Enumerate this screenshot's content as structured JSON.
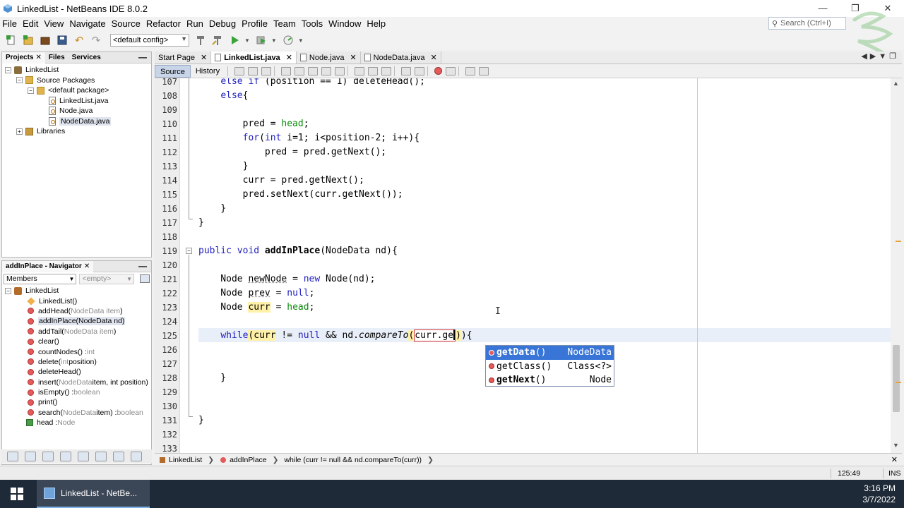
{
  "window": {
    "title": "LinkedList - NetBeans IDE 8.0.2",
    "controls": [
      "—",
      "❐",
      "✕"
    ]
  },
  "menu": [
    "File",
    "Edit",
    "View",
    "Navigate",
    "Source",
    "Refactor",
    "Run",
    "Debug",
    "Profile",
    "Team",
    "Tools",
    "Window",
    "Help"
  ],
  "search": {
    "placeholder": "Search (Ctrl+I)"
  },
  "toolbar": {
    "config": "<default config>"
  },
  "projects_panel": {
    "tabs": [
      "Projects",
      "Files",
      "Services"
    ],
    "tree": [
      {
        "label": "LinkedList",
        "icon": "project-icon",
        "level": 0
      },
      {
        "label": "Source Packages",
        "icon": "package-folder-icon",
        "level": 1
      },
      {
        "label": "<default package>",
        "icon": "package-icon",
        "level": 2
      },
      {
        "label": "LinkedList.java",
        "icon": "java-file-icon",
        "level": 3
      },
      {
        "label": "Node.java",
        "icon": "java-file-icon",
        "level": 3
      },
      {
        "label": "NodeData.java",
        "icon": "java-file-icon",
        "level": 3,
        "selected": true
      },
      {
        "label": "Libraries",
        "icon": "libraries-icon",
        "level": 1
      }
    ]
  },
  "navigator": {
    "title": "addInPlace - Navigator",
    "filter": "Members",
    "filter2": "<empty>",
    "root": "LinkedList",
    "members": [
      {
        "name": "LinkedList()",
        "params": "",
        "ret": "",
        "kind": "constructor"
      },
      {
        "name": "addHead(",
        "params": "NodeData item",
        "close": ")",
        "ret": "",
        "kind": "method"
      },
      {
        "name": "addInPlace(NodeData nd)",
        "params": "",
        "close": "",
        "ret": "",
        "kind": "method",
        "selected": true
      },
      {
        "name": "addTail(",
        "params": "NodeData item",
        "close": ")",
        "ret": "",
        "kind": "method"
      },
      {
        "name": "clear()",
        "params": "",
        "close": "",
        "ret": "",
        "kind": "method"
      },
      {
        "name": "countNodes() : ",
        "params": "",
        "close": "",
        "ret": "int",
        "kind": "method"
      },
      {
        "name": "delete(",
        "params": "int",
        "close": " position)",
        "ret": "",
        "kind": "method"
      },
      {
        "name": "deleteHead()",
        "params": "",
        "close": "",
        "ret": "",
        "kind": "method"
      },
      {
        "name": "insert(",
        "params": "NodeData",
        "close": " item, int position)",
        "ret": "",
        "kind": "method"
      },
      {
        "name": "isEmpty() : ",
        "params": "",
        "close": "",
        "ret": "boolean",
        "kind": "method"
      },
      {
        "name": "print()",
        "params": "",
        "close": "",
        "ret": "",
        "kind": "method"
      },
      {
        "name": "search(",
        "params": "NodeData",
        "close": " item) : ",
        "ret": "boolean",
        "kind": "method"
      },
      {
        "name": "head : ",
        "params": "",
        "close": "",
        "ret": "Node",
        "kind": "field"
      }
    ]
  },
  "editor": {
    "tabs": [
      {
        "label": "Start Page",
        "active": false
      },
      {
        "label": "LinkedList.java",
        "active": true
      },
      {
        "label": "Node.java",
        "active": false
      },
      {
        "label": "NodeData.java",
        "active": false
      }
    ],
    "source_label": "Source",
    "history_label": "History",
    "lines": [
      107,
      108,
      109,
      110,
      111,
      112,
      113,
      114,
      115,
      116,
      117,
      118,
      119,
      120,
      121,
      122,
      123,
      124,
      125,
      126,
      127,
      128,
      129,
      130,
      131,
      132,
      133
    ]
  },
  "completion": {
    "items": [
      {
        "name": "getData",
        "args": "()",
        "type": "NodeData",
        "bold": true,
        "selected": true
      },
      {
        "name": "getClass",
        "args": "()",
        "type": "Class<?>",
        "bold": false,
        "selected": false
      },
      {
        "name": "getNext",
        "args": "()",
        "type": "Node",
        "bold": true,
        "selected": false
      }
    ]
  },
  "breadcrumbs": [
    "LinkedList",
    "addInPlace",
    "while (curr != null && nd.compareTo(curr))"
  ],
  "status": {
    "position": "125:49",
    "mode": "INS"
  },
  "taskbar": {
    "app": "LinkedList - NetBe...",
    "time": "3:16 PM",
    "date": "3/7/2022"
  }
}
